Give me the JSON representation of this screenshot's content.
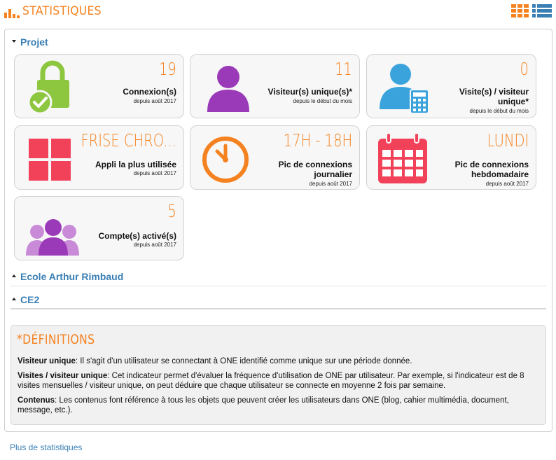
{
  "header": {
    "title": "STATISTIQUES"
  },
  "sections": {
    "projet": "Projet",
    "ecole": "Ecole Arthur Rimbaud",
    "ce2": "CE2"
  },
  "cards": [
    {
      "icon": "lock-check-icon",
      "value": "19",
      "label": "Connexion(s)",
      "sub": "depuis août 2017",
      "icon_color": "#8dc63f"
    },
    {
      "icon": "user-icon",
      "value": "11",
      "label": "Visiteur(s) unique(s)*",
      "sub": "depuis le début du mois",
      "icon_color": "#9b3ab8"
    },
    {
      "icon": "user-calculator-icon",
      "value": "0",
      "label": "Visite(s) / visiteur unique*",
      "sub": "depuis le début du mois",
      "icon_color": "#3aa3dc"
    },
    {
      "icon": "grid-icon",
      "value": "FRISE CHRO...",
      "label": "Appli la plus utilisée",
      "sub": "depuis août 2017",
      "icon_color": "#f2425a"
    },
    {
      "icon": "clock-icon",
      "value": "17H - 18H",
      "label": "Pic de connexions journalier",
      "sub": "depuis août 2017",
      "icon_color": "#f58220"
    },
    {
      "icon": "calendar-icon",
      "value": "LUNDI",
      "label": "Pic de connexions hebdomadaire",
      "sub": "depuis août 2017",
      "icon_color": "#f2425a"
    },
    {
      "icon": "users-group-icon",
      "value": "5",
      "label": "Compte(s) activé(s)",
      "sub": "depuis août 2017",
      "icon_color": "#9b3ab8"
    }
  ],
  "definitions": {
    "title": "*DÉFINITIONS",
    "items": [
      {
        "term": "Visiteur unique",
        "text": ":  Il s'agit d'un utilisateur se connectant à ONE identifié comme unique sur une période donnée."
      },
      {
        "term": "Visites / visiteur unique",
        "text": ":  Cet indicateur permet d'évaluer la fréquence d'utilisation de ONE par utilisateur. Par exemple, si l'indicateur est de 8 visites mensuelles / visiteur unique, on peut déduire que chaque utilisateur se connecte en moyenne 2 fois par semaine."
      },
      {
        "term": "Contenus",
        "text": ":  Les contenus font référence à tous les objets que peuvent créer les utilisateurs dans ONE (blog, cahier multimédia, document, message, etc.)."
      }
    ]
  },
  "footer": {
    "more_link": "Plus de statistiques"
  },
  "colors": {
    "accent": "#f58220",
    "link": "#3a7fb4",
    "list_icon": "#3a7fb4"
  }
}
